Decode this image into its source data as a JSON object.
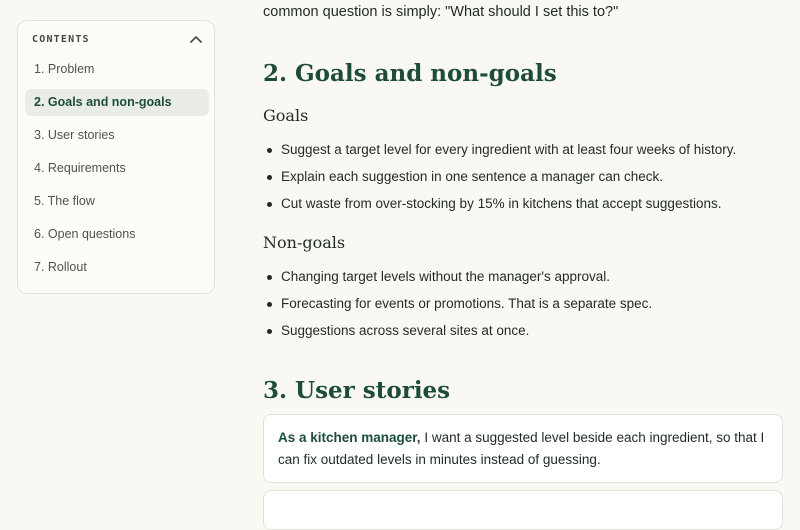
{
  "toc": {
    "title": "CONTENTS",
    "items": [
      {
        "label": "1. Problem",
        "active": false
      },
      {
        "label": "2. Goals and non-goals",
        "active": true
      },
      {
        "label": "3. User stories",
        "active": false
      },
      {
        "label": "4. Requirements",
        "active": false
      },
      {
        "label": "5. The flow",
        "active": false
      },
      {
        "label": "6. Open questions",
        "active": false
      },
      {
        "label": "7. Rollout",
        "active": false
      }
    ]
  },
  "content": {
    "intro_tail": "common question is simply: \"What should I set this to?\"",
    "goals_section": {
      "heading": "2. Goals and non-goals",
      "goals_heading": "Goals",
      "goals": [
        "Suggest a target level for every ingredient with at least four weeks of history.",
        "Explain each suggestion in one sentence a manager can check.",
        "Cut waste from over-stocking by 15% in kitchens that accept suggestions."
      ],
      "nongoals_heading": "Non-goals",
      "nongoals": [
        "Changing target levels without the manager's approval.",
        "Forecasting for events or promotions. That is a separate spec.",
        "Suggestions across several sites at once."
      ]
    },
    "user_stories_section": {
      "heading": "3. User stories",
      "stories": [
        {
          "role": "As a kitchen manager,",
          "text": " I want a suggested level beside each ingredient, so that I can fix outdated levels in minutes instead of guessing."
        }
      ]
    }
  },
  "colors": {
    "background": "#faf8f3",
    "heading": "#1e4d37",
    "active_bg": "#e9ede6",
    "border": "#e3e0d7"
  }
}
